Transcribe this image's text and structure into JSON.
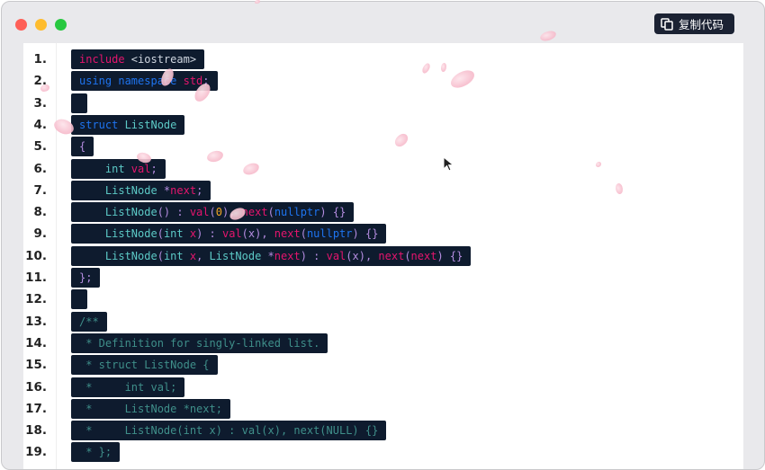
{
  "window": {
    "controls": [
      "close",
      "minimize",
      "maximize"
    ],
    "copy_button": {
      "label": "复制代码",
      "icon": "copy-icon"
    }
  },
  "colors": {
    "window_bg": "#e9e9ec",
    "code_highlight_bg": "#0e1b2e",
    "keyword": "#e5156d",
    "keyword_blue": "#1e74f0",
    "type": "#5cc9c6",
    "comment": "#3f8f8a",
    "number": "#f5a623"
  },
  "code": {
    "lines": [
      {
        "n": "1.",
        "tokens": [
          {
            "t": "include",
            "c": "kw"
          },
          {
            "t": " <iostream>",
            "c": "pl"
          }
        ]
      },
      {
        "n": "2.",
        "tokens": [
          {
            "t": "using namespace",
            "c": "kb"
          },
          {
            "t": " std",
            "c": "kw"
          },
          {
            "t": ";",
            "c": "pu"
          }
        ]
      },
      {
        "n": "3.",
        "tokens": []
      },
      {
        "n": "4.",
        "tokens": [
          {
            "t": "struct",
            "c": "kb"
          },
          {
            "t": " ListNode",
            "c": "ty"
          }
        ]
      },
      {
        "n": "5.",
        "tokens": [
          {
            "t": "{",
            "c": "pu"
          }
        ]
      },
      {
        "n": "6.",
        "tokens": [
          {
            "t": "    int",
            "c": "ty"
          },
          {
            "t": " val",
            "c": "kw"
          },
          {
            "t": ";",
            "c": "pu"
          }
        ]
      },
      {
        "n": "7.",
        "tokens": [
          {
            "t": "    ListNode",
            "c": "ty"
          },
          {
            "t": " *",
            "c": "pu"
          },
          {
            "t": "next",
            "c": "kw"
          },
          {
            "t": ";",
            "c": "pu"
          }
        ]
      },
      {
        "n": "8.",
        "tokens": [
          {
            "t": "    ListNode",
            "c": "ty"
          },
          {
            "t": "() : ",
            "c": "pu"
          },
          {
            "t": "val",
            "c": "kw"
          },
          {
            "t": "(",
            "c": "pu"
          },
          {
            "t": "0",
            "c": "nm"
          },
          {
            "t": "), ",
            "c": "pu"
          },
          {
            "t": "next",
            "c": "kw"
          },
          {
            "t": "(",
            "c": "pu"
          },
          {
            "t": "nullptr",
            "c": "kb"
          },
          {
            "t": ") {}",
            "c": "pu"
          }
        ]
      },
      {
        "n": "9.",
        "tokens": [
          {
            "t": "    ListNode",
            "c": "ty"
          },
          {
            "t": "(",
            "c": "pu"
          },
          {
            "t": "int",
            "c": "ty"
          },
          {
            "t": " x",
            "c": "kw"
          },
          {
            "t": ") : ",
            "c": "pu"
          },
          {
            "t": "val",
            "c": "kw"
          },
          {
            "t": "(x), ",
            "c": "pu"
          },
          {
            "t": "next",
            "c": "kw"
          },
          {
            "t": "(",
            "c": "pu"
          },
          {
            "t": "nullptr",
            "c": "kb"
          },
          {
            "t": ") {}",
            "c": "pu"
          }
        ]
      },
      {
        "n": "10.",
        "tokens": [
          {
            "t": "    ListNode",
            "c": "ty"
          },
          {
            "t": "(",
            "c": "pu"
          },
          {
            "t": "int",
            "c": "ty"
          },
          {
            "t": " x",
            "c": "kw"
          },
          {
            "t": ", ",
            "c": "pu"
          },
          {
            "t": "ListNode",
            "c": "ty"
          },
          {
            "t": " *",
            "c": "pu"
          },
          {
            "t": "next",
            "c": "kw"
          },
          {
            "t": ") : ",
            "c": "pu"
          },
          {
            "t": "val",
            "c": "kw"
          },
          {
            "t": "(x), ",
            "c": "pu"
          },
          {
            "t": "next",
            "c": "kw"
          },
          {
            "t": "(",
            "c": "pu"
          },
          {
            "t": "next",
            "c": "kw"
          },
          {
            "t": ") {}",
            "c": "pu"
          }
        ]
      },
      {
        "n": "11.",
        "tokens": [
          {
            "t": "};",
            "c": "pu"
          }
        ]
      },
      {
        "n": "12.",
        "tokens": []
      },
      {
        "n": "13.",
        "tokens": [
          {
            "t": "/**",
            "c": "cm"
          }
        ]
      },
      {
        "n": "14.",
        "tokens": [
          {
            "t": " * Definition for singly-linked list.",
            "c": "cm"
          }
        ]
      },
      {
        "n": "15.",
        "tokens": [
          {
            "t": " * struct ListNode {",
            "c": "cm"
          }
        ]
      },
      {
        "n": "16.",
        "tokens": [
          {
            "t": " *     int val;",
            "c": "cm"
          }
        ]
      },
      {
        "n": "17.",
        "tokens": [
          {
            "t": " *     ListNode *next;",
            "c": "cm"
          }
        ]
      },
      {
        "n": "18.",
        "tokens": [
          {
            "t": " *     ListNode(int x) : val(x), next(NULL) {}",
            "c": "cm"
          }
        ]
      },
      {
        "n": "19.",
        "tokens": [
          {
            "t": " * };",
            "c": "cm"
          }
        ]
      }
    ]
  }
}
